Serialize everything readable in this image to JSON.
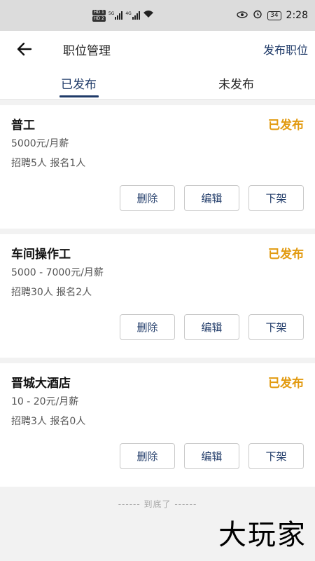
{
  "status_bar": {
    "hd1": "HD 1",
    "hd2": "HD 2",
    "sig1_tag": "5G",
    "sig2_tag": "4G",
    "battery": "34",
    "time": "2:28",
    "icons": [
      "hd-icon",
      "signal-icon",
      "wifi-icon",
      "eye-icon",
      "alarm-icon",
      "battery-icon"
    ]
  },
  "header": {
    "title": "职位管理",
    "publish_label": "发布职位",
    "back_icon": "arrow-left-icon"
  },
  "tabs": [
    {
      "label": "已发布",
      "active": true
    },
    {
      "label": "未发布",
      "active": false
    }
  ],
  "jobs": [
    {
      "name": "普工",
      "status": "已发布",
      "salary": "5000元/月薪",
      "stats": "招聘5人 报名1人"
    },
    {
      "name": "车间操作工",
      "status": "已发布",
      "salary": "5000 - 7000元/月薪",
      "stats": "招聘30人 报名2人"
    },
    {
      "name": "晋城大酒店",
      "status": "已发布",
      "salary": "10 - 20元/月薪",
      "stats": "招聘3人 报名0人"
    }
  ],
  "actions": {
    "delete": "删除",
    "edit": "编辑",
    "offline": "下架"
  },
  "footer": {
    "end_text": "------ 到底了 ------"
  },
  "watermark": "大玩家",
  "colors": {
    "accent": "#1f3a68",
    "status": "#e29a10",
    "background": "#f2f2f2"
  }
}
